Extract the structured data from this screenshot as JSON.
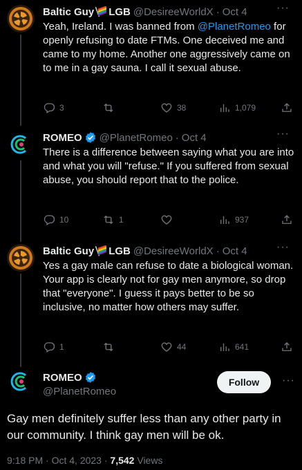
{
  "tweets": [
    {
      "name": "Baltic Guy",
      "name_suffix": "LGB",
      "handle": "@DesireeWorldX",
      "time": "Oct 4",
      "text_pre": "Yeah, Ireland. I was banned from ",
      "mention": "@PlanetRomeo",
      "text_post": " for openly refusing to date FTMs. One deceived me and came to my home. Another one aggressively came on to me in a gay sauna. I call it sexual abuse.",
      "replies": "3",
      "reposts": "",
      "likes": "38",
      "views": "1,079"
    },
    {
      "name": "ROMEO",
      "handle": "@PlanetRomeo",
      "time": "Oct 4",
      "text": "There is a difference between saying what you are into and what you will \"refuse.\" If you suffered from sexual abuse, you should report that to the police.",
      "replies": "10",
      "reposts": "1",
      "likes": "",
      "views": "937"
    },
    {
      "name": "Baltic Guy",
      "name_suffix": "LGB",
      "handle": "@DesireeWorldX",
      "time": "Oct 4",
      "text": "Yes a gay male can refuse to date a biological woman. Your app is clearly not for gay men anymore, so drop that \"everyone\". I guess it pays better to be so inclusive, no matter how others may suffer.",
      "replies": "1",
      "reposts": "",
      "likes": "44",
      "views": "641"
    }
  ],
  "main": {
    "name": "ROMEO",
    "handle": "@PlanetRomeo",
    "follow_label": "Follow",
    "text": "Gay men definitely suffer less than any other party in our community. I think gay men will be ok.",
    "time": "9:18 PM · Oct 4, 2023",
    "views_count": "7,542",
    "views_label": "Views"
  },
  "colors": {
    "accent": "#1d9bf0",
    "muted": "#71767b",
    "text": "#e7e9ea",
    "bg": "#000000"
  },
  "icons": [
    "reply-icon",
    "repost-icon",
    "like-icon",
    "views-icon",
    "share-icon",
    "more-icon",
    "verified-icon",
    "rainbow-flag-icon"
  ]
}
